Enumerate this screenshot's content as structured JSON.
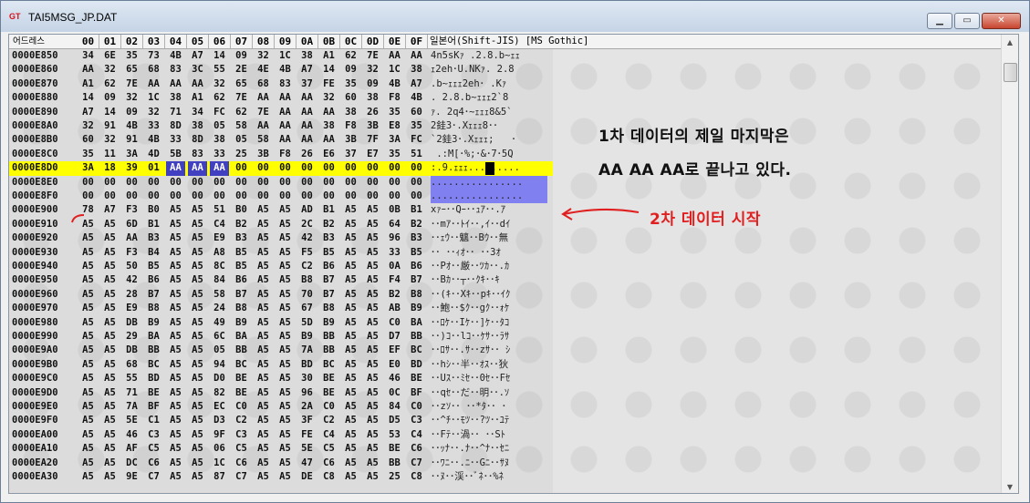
{
  "window": {
    "title": "TAI5MSG_JP.DAT",
    "app_icon_label": "GT",
    "controls": [
      "minimize",
      "maximize",
      "close"
    ]
  },
  "header": {
    "address_label": "어드레스",
    "columns": [
      "00",
      "01",
      "02",
      "03",
      "04",
      "05",
      "06",
      "07",
      "08",
      "09",
      "0A",
      "0B",
      "0C",
      "0D",
      "0E",
      "0F"
    ],
    "text_label": "일본어(Shift-JIS) [MS Gothic]"
  },
  "rows": [
    {
      "addr": "0000E850",
      "bytes": [
        "34",
        "6E",
        "35",
        "73",
        "4B",
        "A7",
        "14",
        "09",
        "32",
        "1C",
        "38",
        "A1",
        "62",
        "7E",
        "AA",
        "AA"
      ],
      "text": "4n5sKｧ .2.8.b~ｪｪ"
    },
    {
      "addr": "0000E860",
      "bytes": [
        "AA",
        "32",
        "65",
        "68",
        "83",
        "3C",
        "55",
        "2E",
        "4E",
        "4B",
        "A7",
        "14",
        "09",
        "32",
        "1C",
        "38"
      ],
      "text": "ｪ2eh･U.NKｧ. 2.8"
    },
    {
      "addr": "0000E870",
      "bytes": [
        "A1",
        "62",
        "7E",
        "AA",
        "AA",
        "AA",
        "32",
        "65",
        "68",
        "83",
        "37",
        "FE",
        "35",
        "09",
        "4B",
        "A7"
      ],
      "text": ".b~ｪｪｪ2eh･ .Kｧ"
    },
    {
      "addr": "0000E880",
      "bytes": [
        "14",
        "09",
        "32",
        "1C",
        "38",
        "A1",
        "62",
        "7E",
        "AA",
        "AA",
        "AA",
        "32",
        "60",
        "38",
        "F8",
        "4B"
      ],
      "text": ". 2.8.b~ｪｪｪ2`8 "
    },
    {
      "addr": "0000E890",
      "bytes": [
        "A7",
        "14",
        "09",
        "32",
        "71",
        "34",
        "FC",
        "62",
        "7E",
        "AA",
        "AA",
        "AA",
        "38",
        "26",
        "35",
        "60"
      ],
      "text": "ｧ. 2q4･~ｪｪｪ8&5`"
    },
    {
      "addr": "0000E8A0",
      "bytes": [
        "32",
        "91",
        "4B",
        "33",
        "8D",
        "38",
        "05",
        "58",
        "AA",
        "AA",
        "AA",
        "38",
        "F8",
        "3B",
        "E8",
        "35"
      ],
      "text": "2銈3･.Xｪｪｪ8･･"
    },
    {
      "addr": "0000E8B0",
      "bytes": [
        "60",
        "32",
        "91",
        "4B",
        "33",
        "8D",
        "38",
        "05",
        "58",
        "AA",
        "AA",
        "AA",
        "3B",
        "7F",
        "3A",
        "FC"
      ],
      "text": "`2銈3･.Xｪｪｪ;   ･"
    },
    {
      "addr": "0000E8C0",
      "bytes": [
        "35",
        "11",
        "3A",
        "4D",
        "5B",
        "83",
        "33",
        "25",
        "3B",
        "F8",
        "26",
        "E6",
        "37",
        "E7",
        "35",
        "51"
      ],
      "text": " .:M[･%;･&･7･5Q"
    },
    {
      "addr": "0000E8D0",
      "bytes": [
        "3A",
        "18",
        "39",
        "01",
        "AA",
        "AA",
        "AA",
        "00",
        "00",
        "00",
        "00",
        "00",
        "00",
        "00",
        "00",
        "00"
      ],
      "text": ":.9.ｪｪｪ........."
    },
    {
      "addr": "0000E8E0",
      "bytes": [
        "00",
        "00",
        "00",
        "00",
        "00",
        "00",
        "00",
        "00",
        "00",
        "00",
        "00",
        "00",
        "00",
        "00",
        "00",
        "00"
      ],
      "text": "................"
    },
    {
      "addr": "0000E8F0",
      "bytes": [
        "00",
        "00",
        "00",
        "00",
        "00",
        "00",
        "00",
        "00",
        "00",
        "00",
        "00",
        "00",
        "00",
        "00",
        "00",
        "00"
      ],
      "text": "................"
    },
    {
      "addr": "0000E900",
      "bytes": [
        "78",
        "A7",
        "F3",
        "B0",
        "A5",
        "A5",
        "51",
        "B0",
        "A5",
        "A5",
        "AD",
        "B1",
        "A5",
        "A5",
        "0B",
        "B1"
      ],
      "text": "xｧｰ･･Qｰ･･ｭｱ･･.ｱ"
    },
    {
      "addr": "0000E910",
      "bytes": [
        "A5",
        "A5",
        "6D",
        "B1",
        "A5",
        "A5",
        "C4",
        "B2",
        "A5",
        "A5",
        "2C",
        "B2",
        "A5",
        "A5",
        "64",
        "B2"
      ],
      "text": "･･mｱ･･ﾄｲ･･,ｲ･･dｲ"
    },
    {
      "addr": "0000E920",
      "bytes": [
        "A5",
        "A5",
        "AA",
        "B3",
        "A5",
        "A5",
        "E9",
        "B3",
        "A5",
        "A5",
        "42",
        "B3",
        "A5",
        "A5",
        "96",
        "B3"
      ],
      "text": "･･ｪｳ･･魑･･Bｳ･･無"
    },
    {
      "addr": "0000E930",
      "bytes": [
        "A5",
        "A5",
        "F3",
        "B4",
        "A5",
        "A5",
        "A8",
        "B5",
        "A5",
        "A5",
        "F5",
        "B5",
        "A5",
        "A5",
        "33",
        "B5"
      ],
      "text": "･･ ･･ｨｵ･･ ･･3ｵ"
    },
    {
      "addr": "0000E940",
      "bytes": [
        "A5",
        "A5",
        "50",
        "B5",
        "A5",
        "A5",
        "8C",
        "B5",
        "A5",
        "A5",
        "C2",
        "B6",
        "A5",
        "A5",
        "0A",
        "B6"
      ],
      "text": "･･Pｵ･･厳･･ﾂｶ･･.ｶ"
    },
    {
      "addr": "0000E950",
      "bytes": [
        "A5",
        "A5",
        "42",
        "B6",
        "A5",
        "A5",
        "84",
        "B6",
        "A5",
        "A5",
        "B8",
        "B7",
        "A5",
        "A5",
        "F4",
        "B7"
      ],
      "text": "･･Bｶ･･┬･･ｸｷ･･ｷ"
    },
    {
      "addr": "0000E960",
      "bytes": [
        "A5",
        "A5",
        "28",
        "B7",
        "A5",
        "A5",
        "58",
        "B7",
        "A5",
        "A5",
        "70",
        "B7",
        "A5",
        "A5",
        "B2",
        "B8"
      ],
      "text": "･･(ｷ･･Xｷ･･pｷ･･ｲｸ"
    },
    {
      "addr": "0000E970",
      "bytes": [
        "A5",
        "A5",
        "E9",
        "B8",
        "A5",
        "A5",
        "24",
        "B8",
        "A5",
        "A5",
        "67",
        "B8",
        "A5",
        "A5",
        "AB",
        "B9"
      ],
      "text": "･･鮑･･$ｸ･･gｸ･･ｫｹ"
    },
    {
      "addr": "0000E980",
      "bytes": [
        "A5",
        "A5",
        "DB",
        "B9",
        "A5",
        "A5",
        "49",
        "B9",
        "A5",
        "A5",
        "5D",
        "B9",
        "A5",
        "A5",
        "C0",
        "BA"
      ],
      "text": "･･ﾛｹ･･Iｹ･･]ｹ･･ﾀｺ"
    },
    {
      "addr": "0000E990",
      "bytes": [
        "A5",
        "A5",
        "29",
        "BA",
        "A5",
        "A5",
        "6C",
        "BA",
        "A5",
        "A5",
        "B9",
        "BB",
        "A5",
        "A5",
        "D7",
        "BB"
      ],
      "text": "･･)ｺ･･lｺ･･ｹｻ･･ﾗｻ"
    },
    {
      "addr": "0000E9A0",
      "bytes": [
        "A5",
        "A5",
        "DB",
        "BB",
        "A5",
        "A5",
        "05",
        "BB",
        "A5",
        "A5",
        "7A",
        "BB",
        "A5",
        "A5",
        "EF",
        "BC"
      ],
      "text": "･･ﾛｻ･･.ｻ･･zｻ･･ ｼ"
    },
    {
      "addr": "0000E9B0",
      "bytes": [
        "A5",
        "A5",
        "68",
        "BC",
        "A5",
        "A5",
        "94",
        "BC",
        "A5",
        "A5",
        "BD",
        "BC",
        "A5",
        "A5",
        "E0",
        "BD"
      ],
      "text": "･･hｼ･･半･･ｵｽ･･狄"
    },
    {
      "addr": "0000E9C0",
      "bytes": [
        "A5",
        "A5",
        "55",
        "BD",
        "A5",
        "A5",
        "D0",
        "BE",
        "A5",
        "A5",
        "30",
        "BE",
        "A5",
        "A5",
        "46",
        "BE"
      ],
      "text": "･･Uｽ･･ﾐｾ･･0ｾ･･Fｾ"
    },
    {
      "addr": "0000E9D0",
      "bytes": [
        "A5",
        "A5",
        "71",
        "BE",
        "A5",
        "A5",
        "82",
        "BE",
        "A5",
        "A5",
        "96",
        "BE",
        "A5",
        "A5",
        "0C",
        "BF"
      ],
      "text": "･･qｾ･･だ･･明･･.ｿ"
    },
    {
      "addr": "0000E9E0",
      "bytes": [
        "A5",
        "A5",
        "7A",
        "BF",
        "A5",
        "A5",
        "EC",
        "C0",
        "A5",
        "A5",
        "2A",
        "C0",
        "A5",
        "A5",
        "84",
        "C0"
      ],
      "text": "･･zｿ･･ ･･*ﾀ･･ ･"
    },
    {
      "addr": "0000E9F0",
      "bytes": [
        "A5",
        "A5",
        "5E",
        "C1",
        "A5",
        "A5",
        "D3",
        "C2",
        "A5",
        "A5",
        "3F",
        "C2",
        "A5",
        "A5",
        "D5",
        "C3"
      ],
      "text": "･･^ﾁ･･ﾓﾂ･･?ﾂ･･ﾕﾃ"
    },
    {
      "addr": "0000EA00",
      "bytes": [
        "A5",
        "A5",
        "46",
        "C3",
        "A5",
        "A5",
        "9F",
        "C3",
        "A5",
        "A5",
        "FE",
        "C4",
        "A5",
        "A5",
        "53",
        "C4"
      ],
      "text": "･･Fﾃ･･渦･･ ･･Sﾄ"
    },
    {
      "addr": "0000EA10",
      "bytes": [
        "A5",
        "A5",
        "AF",
        "C5",
        "A5",
        "A5",
        "06",
        "C5",
        "A5",
        "A5",
        "5E",
        "C5",
        "A5",
        "A5",
        "BE",
        "C6"
      ],
      "text": "･･ｯﾅ･･.ﾅ･･^ﾅ･･ｾﾆ"
    },
    {
      "addr": "0000EA20",
      "bytes": [
        "A5",
        "A5",
        "DC",
        "C6",
        "A5",
        "A5",
        "1C",
        "C6",
        "A5",
        "A5",
        "47",
        "C6",
        "A5",
        "A5",
        "BB",
        "C7"
      ],
      "text": "･･ﾜﾆ･･.ﾆ･･Gﾆ･･ｻﾇ"
    },
    {
      "addr": "0000EA30",
      "bytes": [
        "A5",
        "A5",
        "9E",
        "C7",
        "A5",
        "A5",
        "87",
        "C7",
        "A5",
        "A5",
        "DE",
        "C8",
        "A5",
        "A5",
        "25",
        "C8"
      ],
      "text": "･･ﾇ･･渓･･ﾞﾈ･･%ﾈ"
    }
  ],
  "annotations": {
    "note_line1": "1차 데이터의 제일 마지막은",
    "note_line2": "AA AA AA로 끝나고 있다.",
    "note_red": "2차 데이터 시작"
  },
  "colors": {
    "highlight_row": "#ffff00",
    "selection": "#8080f0",
    "annotation_red": "#e02020"
  }
}
